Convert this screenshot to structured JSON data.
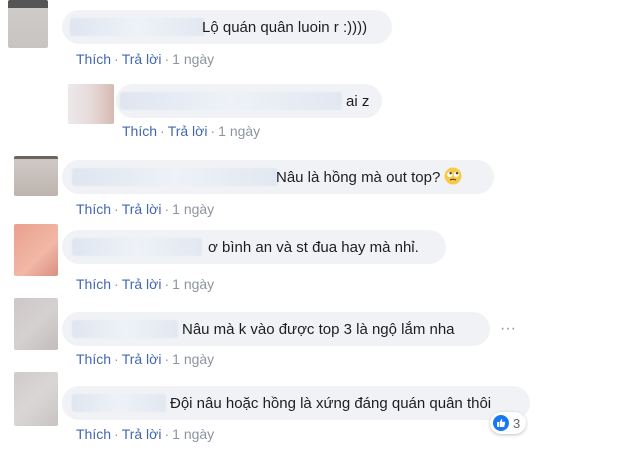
{
  "labels": {
    "like": "Thích",
    "reply": "Trả lời",
    "separator": "·"
  },
  "comments": [
    {
      "text": "Lộ quán quân luoin r :))))",
      "time": "1 ngày"
    },
    {
      "text": "ai z",
      "time": "1 ngày"
    },
    {
      "text": "Nâu là hồng mà out top?",
      "emoji": "rolling-eyes-emoji",
      "time": "1 ngày"
    },
    {
      "text": "ơ bình an và st đua hay mà nhỉ.",
      "time": "1 ngày"
    },
    {
      "text": "Nâu mà k vào được top 3 là ngộ lắm nha",
      "time": "1 ngày"
    },
    {
      "text": "Đội nâu hoặc hồng là xứng đáng quán quân thôi",
      "time": "1 ngày",
      "reaction": {
        "icon": "like-icon",
        "count": "3"
      }
    }
  ],
  "colors": {
    "link": "#4267b2",
    "meta": "#8d949e",
    "bubble": "#f0f2f5",
    "text": "#1c1e21",
    "like": "#1877f2"
  }
}
